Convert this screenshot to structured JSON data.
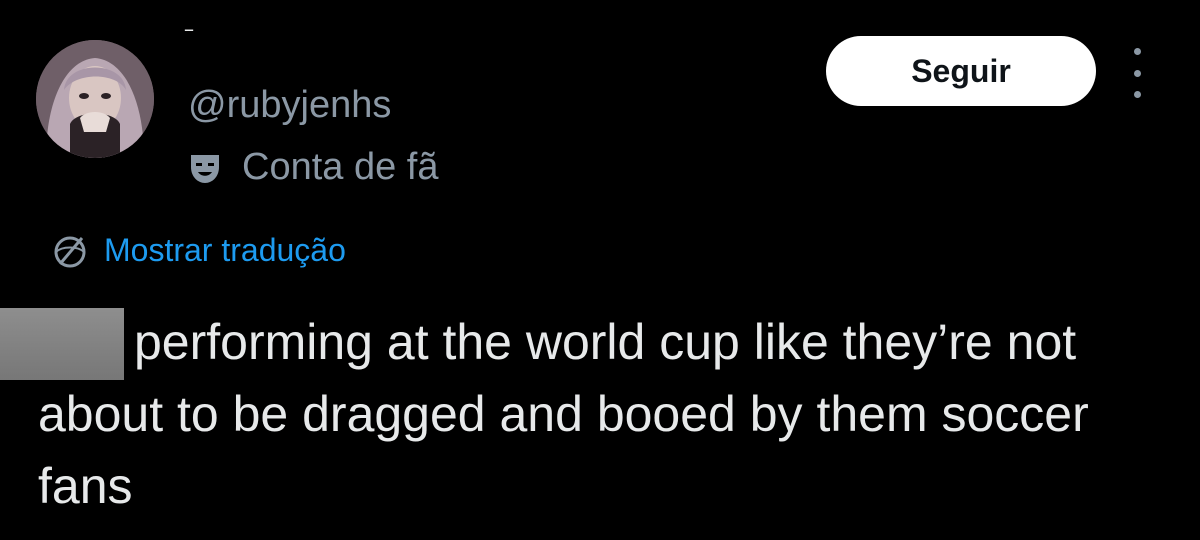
{
  "author": {
    "display_name": "‾",
    "handle": "@rubyjenhs",
    "label_icon": "theater-mask-icon",
    "label_text": "Conta de fã"
  },
  "actions": {
    "follow_label": "Seguir",
    "more_icon": "more-vertical-icon"
  },
  "translate": {
    "icon": "globe-icon",
    "label": "Mostrar tradução"
  },
  "tweet": {
    "text": "performing at the world cup like they’re not about to be dragged and booed by them soccer fans"
  },
  "colors": {
    "background": "#000000",
    "text_primary": "#e7e9ea",
    "text_secondary": "#8b98a5",
    "link": "#1d9bf0",
    "button_bg": "#ffffff",
    "button_text": "#0f1419",
    "redaction": "#808080"
  }
}
